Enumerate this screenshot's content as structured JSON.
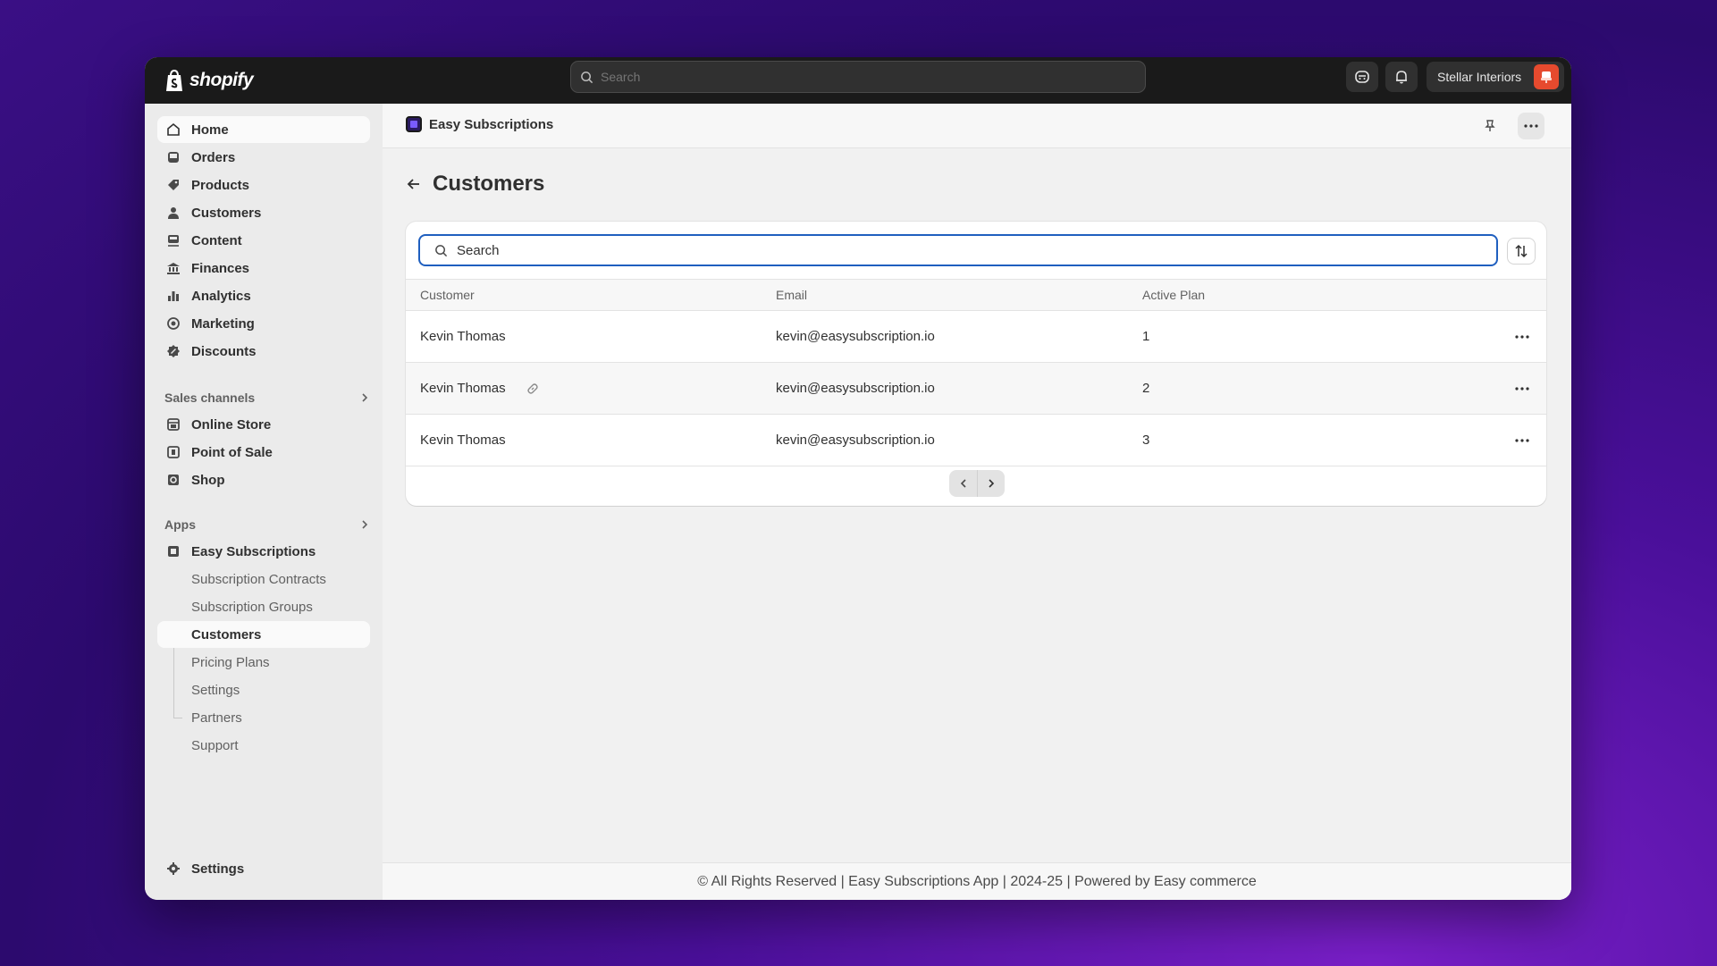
{
  "topbar": {
    "brand": "shopify",
    "search_placeholder": "Search",
    "store_name": "Stellar Interiors"
  },
  "sidebar": {
    "main_items": [
      {
        "label": "Home",
        "icon": "home-icon"
      },
      {
        "label": "Orders",
        "icon": "inbox-icon"
      },
      {
        "label": "Products",
        "icon": "tag-icon"
      },
      {
        "label": "Customers",
        "icon": "person-icon"
      },
      {
        "label": "Content",
        "icon": "content-icon"
      },
      {
        "label": "Finances",
        "icon": "bank-icon"
      },
      {
        "label": "Analytics",
        "icon": "bar-chart-icon"
      },
      {
        "label": "Marketing",
        "icon": "target-icon"
      },
      {
        "label": "Discounts",
        "icon": "discount-icon"
      }
    ],
    "sales_channels_label": "Sales channels",
    "sales_channels": [
      {
        "label": "Online Store",
        "icon": "store-icon"
      },
      {
        "label": "Point of Sale",
        "icon": "pos-icon"
      },
      {
        "label": "Shop",
        "icon": "shop-icon"
      }
    ],
    "apps_label": "Apps",
    "app_name": "Easy Subscriptions",
    "app_sub_items": [
      "Subscription Contracts",
      "Subscription Groups",
      "Customers",
      "Pricing Plans",
      "Settings",
      "Partners",
      "Support"
    ],
    "settings_label": "Settings"
  },
  "app_header": {
    "title": "Easy Subscriptions"
  },
  "page": {
    "title": "Customers",
    "search_value": "Search"
  },
  "table": {
    "columns": [
      "Customer",
      "Email",
      "Active Plan"
    ],
    "rows": [
      {
        "customer": "Kevin Thomas",
        "email": "kevin@easysubscription.io",
        "plan": "1"
      },
      {
        "customer": "Kevin Thomas",
        "email": "kevin@easysubscription.io",
        "plan": "2"
      },
      {
        "customer": "Kevin Thomas",
        "email": "kevin@easysubscription.io",
        "plan": "3"
      }
    ]
  },
  "footer": {
    "text": "© All Rights Reserved | Easy Subscriptions App | 2024-25 | Powered by Easy commerce"
  },
  "colors": {
    "accent": "#1f5fbf",
    "topbar": "#1a1a1a"
  }
}
